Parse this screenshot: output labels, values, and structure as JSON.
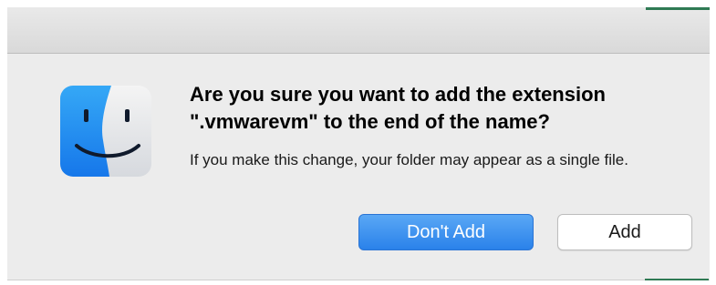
{
  "dialog": {
    "title": "Are you sure you want to add the extension\n\".vmwarevm\" to the end of the name?",
    "message": "If you make this change, your folder may appear as a single file.",
    "primary_button": "Don't Add",
    "secondary_button": "Add",
    "app_icon": "finder-icon"
  },
  "colors": {
    "primary_button": "#2a82ea",
    "sheet_background": "#ececec",
    "accent_green": "#2f7a54"
  }
}
